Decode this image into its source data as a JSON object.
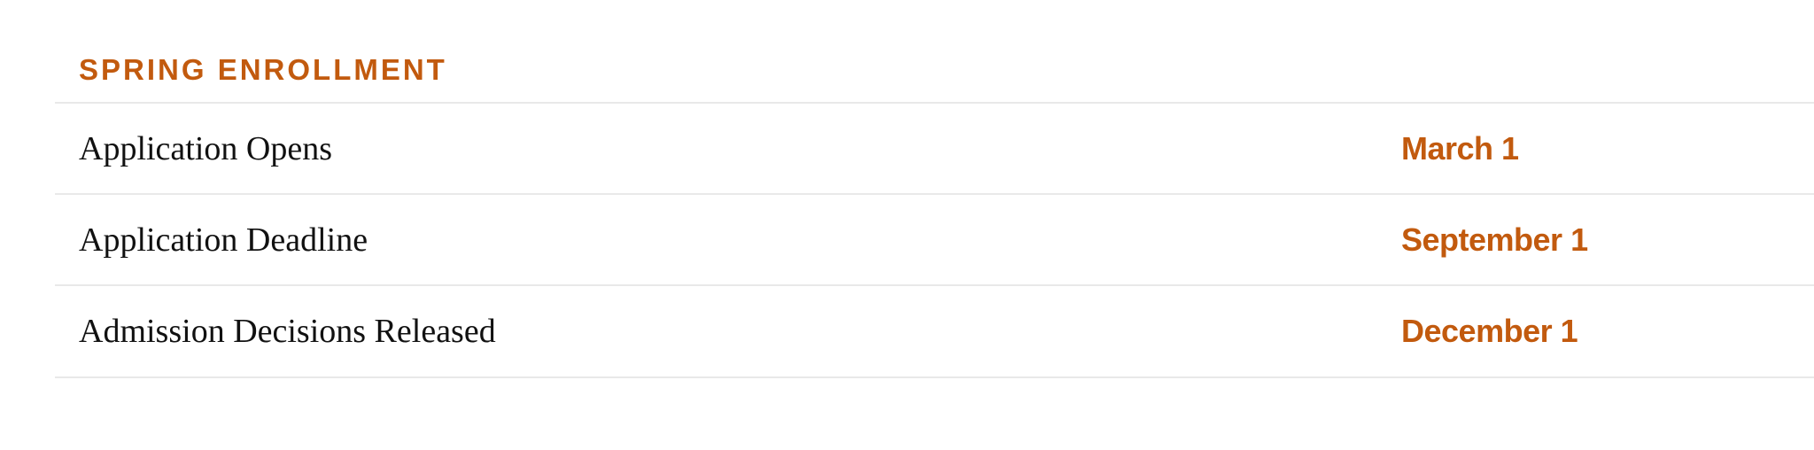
{
  "schedule": {
    "heading": "SPRING ENROLLMENT",
    "accent_color": "#c25a0e",
    "rows": [
      {
        "event": "Application Opens",
        "date": "March 1"
      },
      {
        "event": "Application Deadline",
        "date": "September 1"
      },
      {
        "event": "Admission Decisions Released",
        "date": "December 1"
      }
    ]
  }
}
